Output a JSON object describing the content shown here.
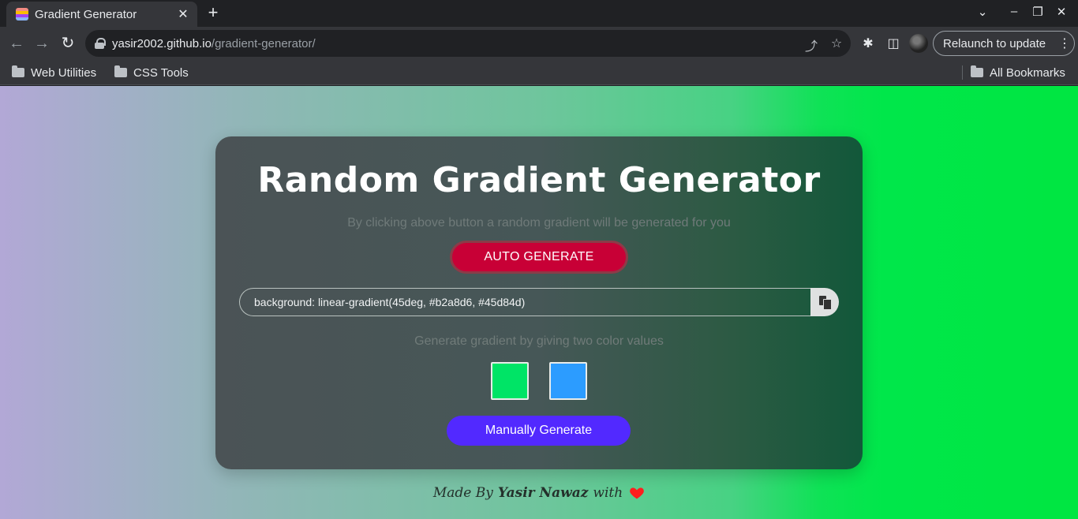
{
  "browser": {
    "tab_title": "Gradient Generator",
    "tab_close_glyph": "✕",
    "new_tab_glyph": "+",
    "url_host": "yasir2002.github.io",
    "url_path": "/gradient-generator/",
    "relaunch_label": "Relaunch to update",
    "bookmarks": [
      "Web Utilities",
      "CSS Tools"
    ],
    "all_bookmarks": "All Bookmarks",
    "icons": {
      "back": "←",
      "forward": "→",
      "reload": "↻",
      "share": "⤴",
      "star": "☆",
      "extensions": "✱",
      "sidepanel": "◫",
      "kebab": "⋮",
      "chevron": "⌄",
      "minimize": "–",
      "restore": "❐",
      "close": "✕"
    }
  },
  "page": {
    "title": "Random Gradient Generator",
    "subtitle": "By clicking above button a random gradient will be generated for you",
    "auto_button": "AUTO GENERATE",
    "gradient_code": "background: linear-gradient(45deg, #b2a8d6, #45d84d)",
    "manual_subtitle": "Generate gradient by giving two color values",
    "color1": "#00e466",
    "color2": "#2c9cff",
    "manual_button": "Manually Generate",
    "footer": {
      "prefix": "Made By",
      "author": "Yasir Nawaz",
      "suffix": "with"
    },
    "colors": {
      "accent_red": "#c80036",
      "accent_purple": "#5229ff",
      "heart": "#ff1e1e"
    }
  }
}
